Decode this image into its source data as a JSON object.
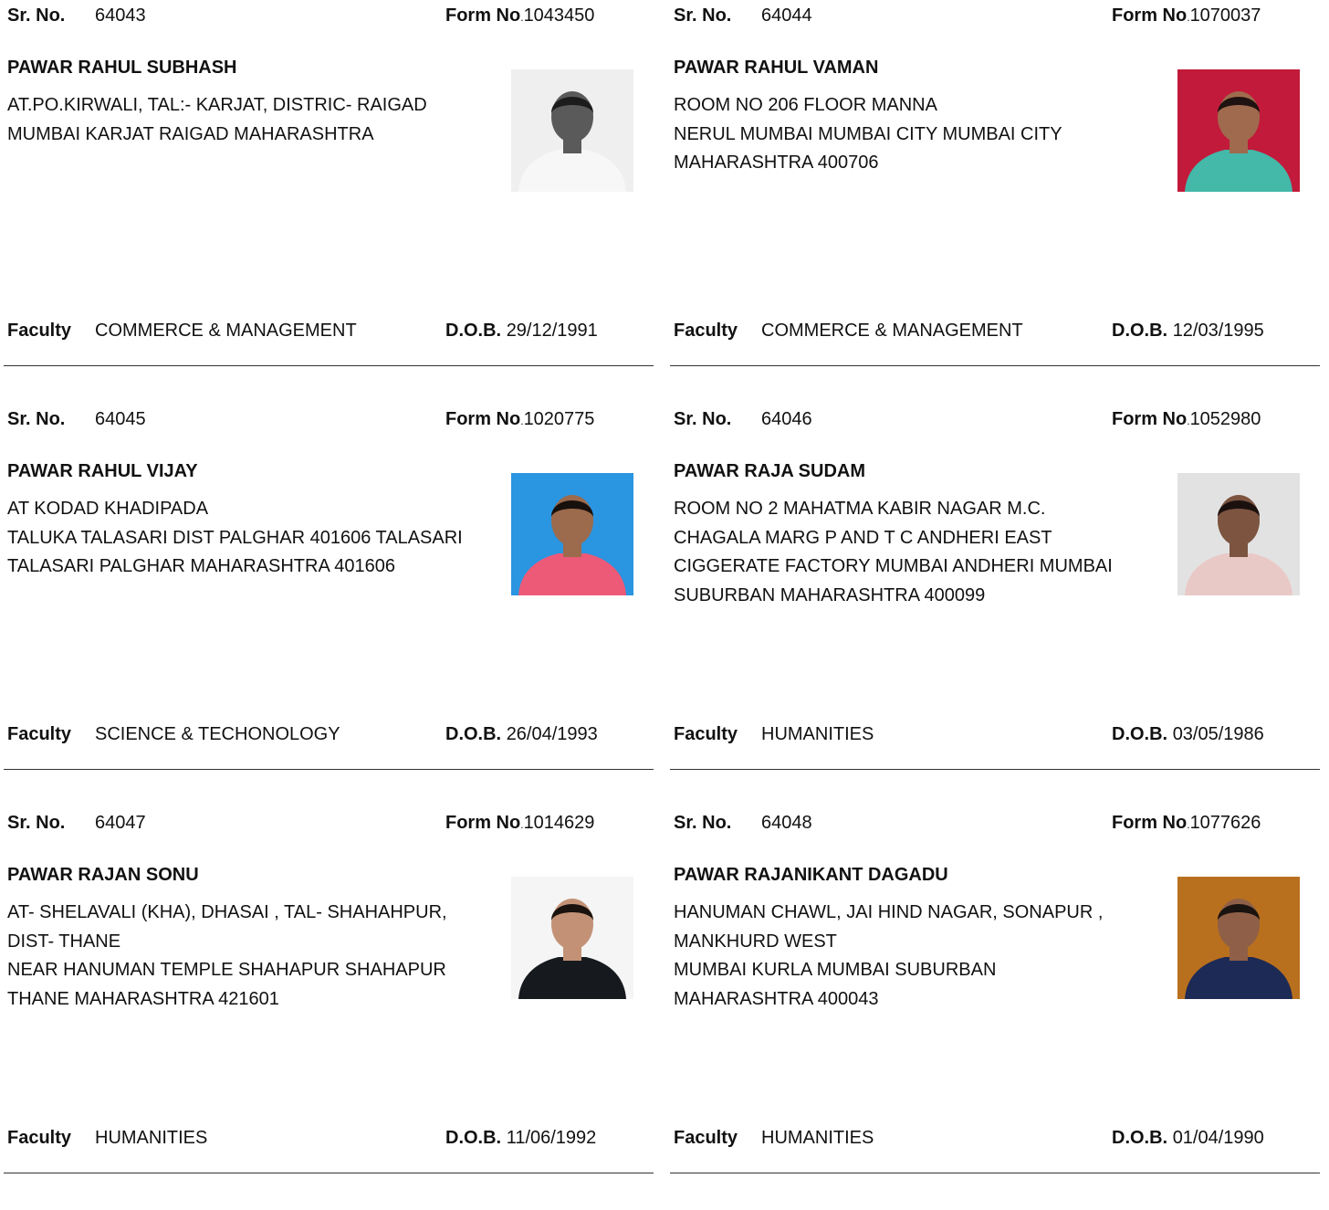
{
  "labels": {
    "sr_no": "Sr. No.",
    "form_no": "Form No",
    "form_no_dot": ".",
    "faculty": "Faculty",
    "dob": "D.O.B."
  },
  "records": [
    {
      "sr_no": "64043",
      "form_no": "1043450",
      "name": "PAWAR RAHUL SUBHASH",
      "address": [
        "AT.PO.KIRWALI, TAL:- KARJAT, DISTRIC- RAIGAD",
        " MUMBAI KARJAT RAIGAD MAHARASHTRA"
      ],
      "faculty": "COMMERCE & MANAGEMENT",
      "dob": "29/12/1991",
      "photo": {
        "bg": "#efefef",
        "shirt": "#f7f7f7",
        "skin": "#5a5a5a",
        "hair": "#1c1c1c"
      }
    },
    {
      "sr_no": "64044",
      "form_no": "1070037",
      "name": "PAWAR RAHUL VAMAN",
      "address": [
        "ROOM NO 206 FLOOR MANNA",
        "NERUL MUMBAI MUMBAI CITY MUMBAI CITY",
        "MAHARASHTRA 400706"
      ],
      "faculty": "COMMERCE & MANAGEMENT",
      "dob": "12/03/1995",
      "photo": {
        "bg": "#c21a3a",
        "shirt": "#44b8a9",
        "skin": "#a06a4e",
        "hair": "#1f1210"
      }
    },
    {
      "sr_no": "64045",
      "form_no": "1020775",
      "name": "PAWAR RAHUL VIJAY",
      "address": [
        "AT KODAD KHADIPADA",
        "TALUKA TALASARI DIST PALGHAR 401606 TALASARI",
        "TALASARI PALGHAR MAHARASHTRA 401606"
      ],
      "faculty": "SCIENCE & TECHONOLOGY",
      "dob": "26/04/1993",
      "photo": {
        "bg": "#2a95e0",
        "shirt": "#ec5a78",
        "skin": "#9c6a4c",
        "hair": "#17100c"
      }
    },
    {
      "sr_no": "64046",
      "form_no": "1052980",
      "name": "PAWAR RAJA SUDAM",
      "address": [
        "ROOM NO 2 MAHATMA KABIR NAGAR M.C.",
        "CHAGALA MARG P AND T C ANDHERI EAST",
        "CIGGERATE FACTORY MUMBAI ANDHERI MUMBAI",
        "SUBURBAN MAHARASHTRA 400099"
      ],
      "faculty": "HUMANITIES",
      "dob": "03/05/1986",
      "photo": {
        "bg": "#e2e2e2",
        "shirt": "#e9c9c6",
        "skin": "#7c5440",
        "hair": "#1a110e"
      }
    },
    {
      "sr_no": "64047",
      "form_no": "1014629",
      "name": "PAWAR RAJAN SONU",
      "address": [
        "AT- SHELAVALI (KHA), DHASAI , TAL- SHAHAHPUR,",
        "DIST- THANE",
        "NEAR HANUMAN TEMPLE SHAHAPUR SHAHAPUR",
        "THANE MAHARASHTRA 421601"
      ],
      "faculty": "HUMANITIES",
      "dob": "11/06/1992",
      "photo": {
        "bg": "#f5f5f5",
        "shirt": "#16191e",
        "skin": "#c39276",
        "hair": "#1a120e"
      }
    },
    {
      "sr_no": "64048",
      "form_no": "1077626",
      "name": "PAWAR RAJANIKANT DAGADU",
      "address": [
        "HANUMAN CHAWL, JAI HIND NAGAR, SONAPUR ,",
        "MANKHURD WEST",
        " MUMBAI KURLA MUMBAI SUBURBAN",
        "MAHARASHTRA 400043"
      ],
      "faculty": "HUMANITIES",
      "dob": "01/04/1990",
      "photo": {
        "bg": "#b9701e",
        "shirt": "#1d2a55",
        "skin": "#8f6047",
        "hair": "#1a1310"
      }
    }
  ]
}
